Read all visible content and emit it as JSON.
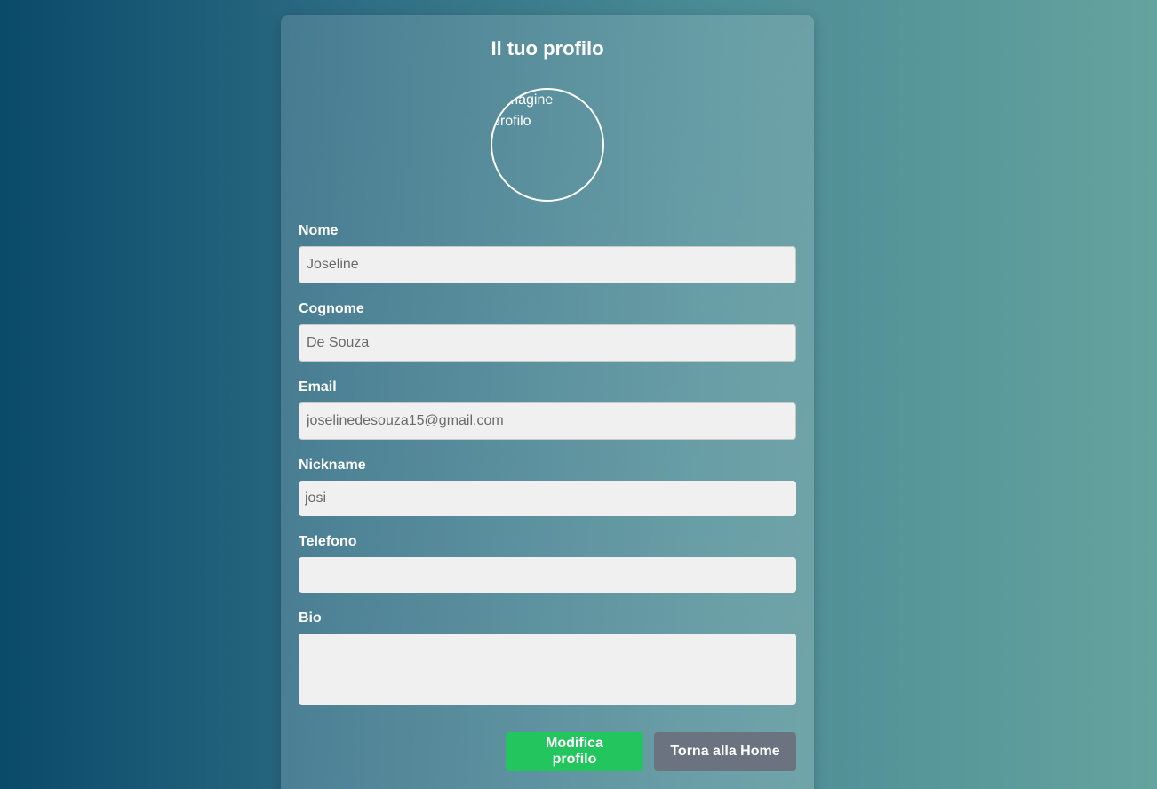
{
  "profile": {
    "title": "Il tuo profilo",
    "avatar_alt": "Immagine profilo"
  },
  "fields": {
    "nome": {
      "label": "Nome",
      "value": "Joseline"
    },
    "cognome": {
      "label": "Cognome",
      "value": "De Souza"
    },
    "email": {
      "label": "Email",
      "value": "joselinedesouza15@gmail.com"
    },
    "nickname": {
      "label": "Nickname",
      "value": "josi"
    },
    "telefono": {
      "label": "Telefono",
      "value": ""
    },
    "bio": {
      "label": "Bio",
      "value": ""
    }
  },
  "actions": {
    "edit_label": "Modifica profilo",
    "home_label": "Torna alla Home"
  },
  "colors": {
    "edit_button": "#22c55e",
    "home_button": "#6b7280"
  }
}
